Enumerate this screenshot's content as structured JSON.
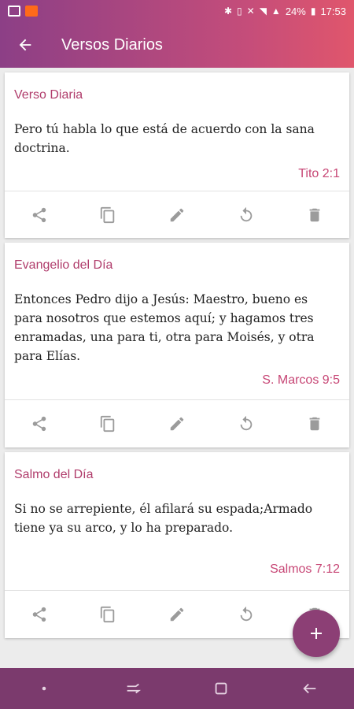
{
  "status_bar": {
    "battery": "24%",
    "time": "17:53"
  },
  "app_bar": {
    "title": "Versos Diarios"
  },
  "cards": [
    {
      "title": "Verso Diaria",
      "text": "Pero tú habla lo que está de acuerdo con la sana doctrina.",
      "reference": "Tito 2:1"
    },
    {
      "title": "Evangelio del Día",
      "text": "Entonces Pedro dijo a Jesús: Maestro, bueno es para nosotros que estemos aquí; y hagamos tres enramadas, una para ti, otra para Moisés, y otra para Elías.",
      "reference": "S. Marcos 9:5"
    },
    {
      "title": "Salmo del Día",
      "text": "Si no se arrepiente, él afilará su espada;Armado tiene ya su arco, y lo ha preparado.",
      "reference": "Salmos 7:12"
    }
  ],
  "card_actions": [
    "share-icon",
    "copy-icon",
    "edit-icon",
    "refresh-icon",
    "delete-icon"
  ],
  "colors": {
    "accent": "#b03c6b",
    "reference": "#c74675",
    "fab": "#8c3f75",
    "nav_bar": "#7b3a6d"
  }
}
